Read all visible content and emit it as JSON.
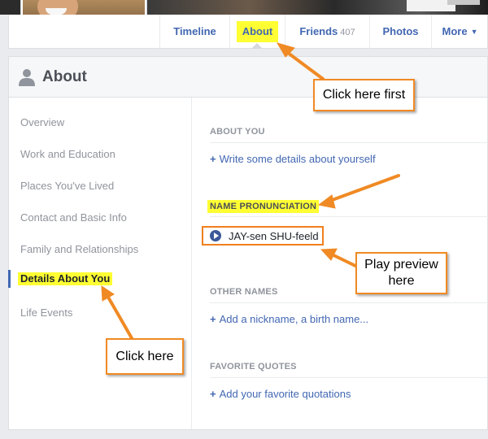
{
  "nav": {
    "tabs": [
      {
        "label": "Timeline"
      },
      {
        "label": "About"
      },
      {
        "label": "Friends",
        "count": "407"
      },
      {
        "label": "Photos"
      },
      {
        "label": "More"
      }
    ]
  },
  "card": {
    "title": "About"
  },
  "sidebar": {
    "items": [
      {
        "label": "Overview"
      },
      {
        "label": "Work and Education"
      },
      {
        "label": "Places You've Lived"
      },
      {
        "label": "Contact and Basic Info"
      },
      {
        "label": "Family and Relationships"
      },
      {
        "label": "Details About You"
      },
      {
        "label": "Life Events"
      }
    ]
  },
  "main": {
    "about_you": {
      "heading": "ABOUT YOU",
      "link": "Write some details about yourself"
    },
    "name_pronunciation": {
      "heading": "NAME PRONUNCIATION",
      "value": "JAY-sen SHU-feeld"
    },
    "other_names": {
      "heading": "OTHER NAMES",
      "link": "Add a nickname, a birth name..."
    },
    "favorite_quotes": {
      "heading": "FAVORITE QUOTES",
      "link": "Add your favorite quotations"
    }
  },
  "callouts": {
    "first": "Click here first",
    "play_line1": "Play preview",
    "play_line2": "here",
    "click_here": "Click here"
  },
  "colors": {
    "link_blue": "#4267b2",
    "highlight": "#ffff33",
    "callout_orange": "#f08a24"
  }
}
